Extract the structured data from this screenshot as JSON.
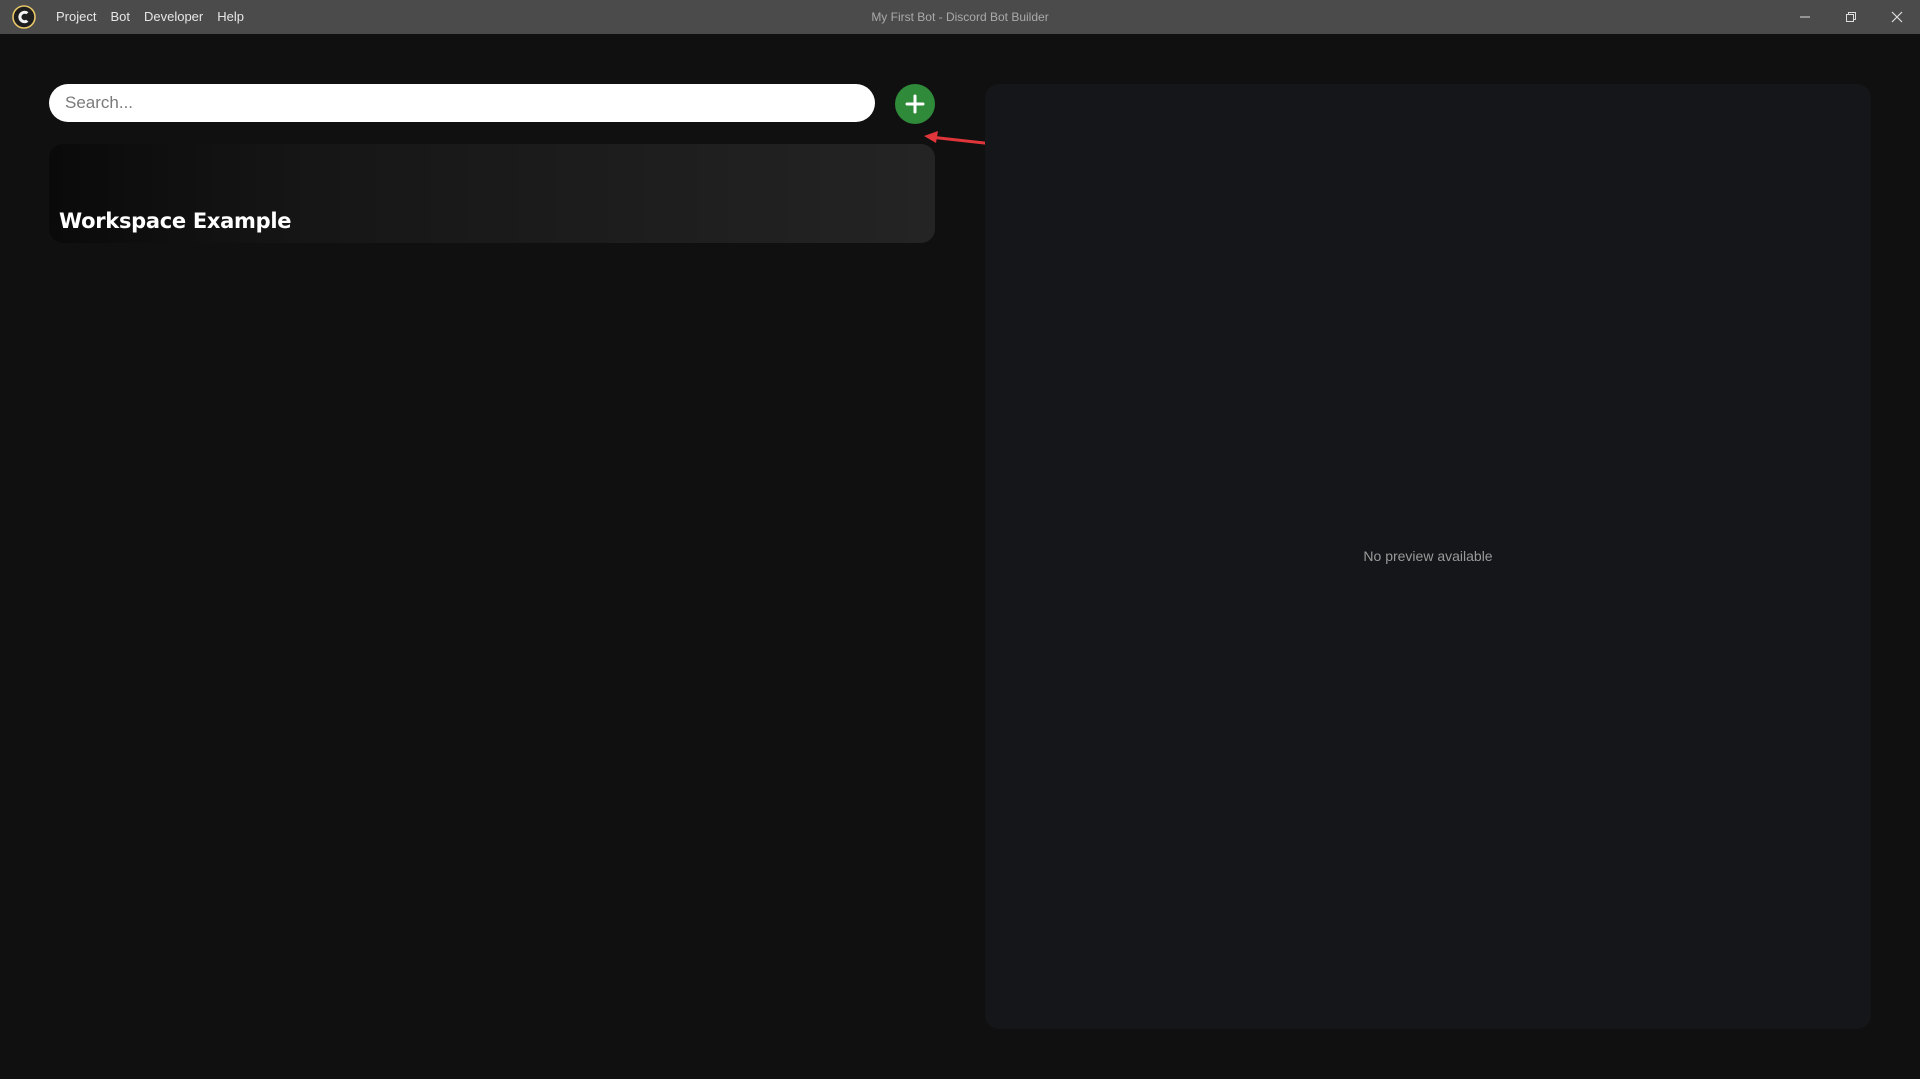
{
  "window": {
    "title": "My First Bot - Discord Bot Builder"
  },
  "menu": {
    "items": [
      {
        "label": "Project"
      },
      {
        "label": "Bot"
      },
      {
        "label": "Developer"
      },
      {
        "label": "Help"
      }
    ]
  },
  "search": {
    "placeholder": "Search...",
    "value": ""
  },
  "workspaces": [
    {
      "title": "Workspace Example"
    }
  ],
  "preview": {
    "empty_text": "No preview available"
  },
  "colors": {
    "titlebar": "#4b4b4b",
    "background": "#101010",
    "add_button": "#2f8a3a",
    "annotation_arrow": "#e0353a",
    "preview_panel": "#15161a"
  },
  "icons": {
    "logo": "app-logo-icon",
    "add": "plus-icon",
    "minimize": "minimize-icon",
    "maximize": "restore-icon",
    "close": "close-icon"
  }
}
